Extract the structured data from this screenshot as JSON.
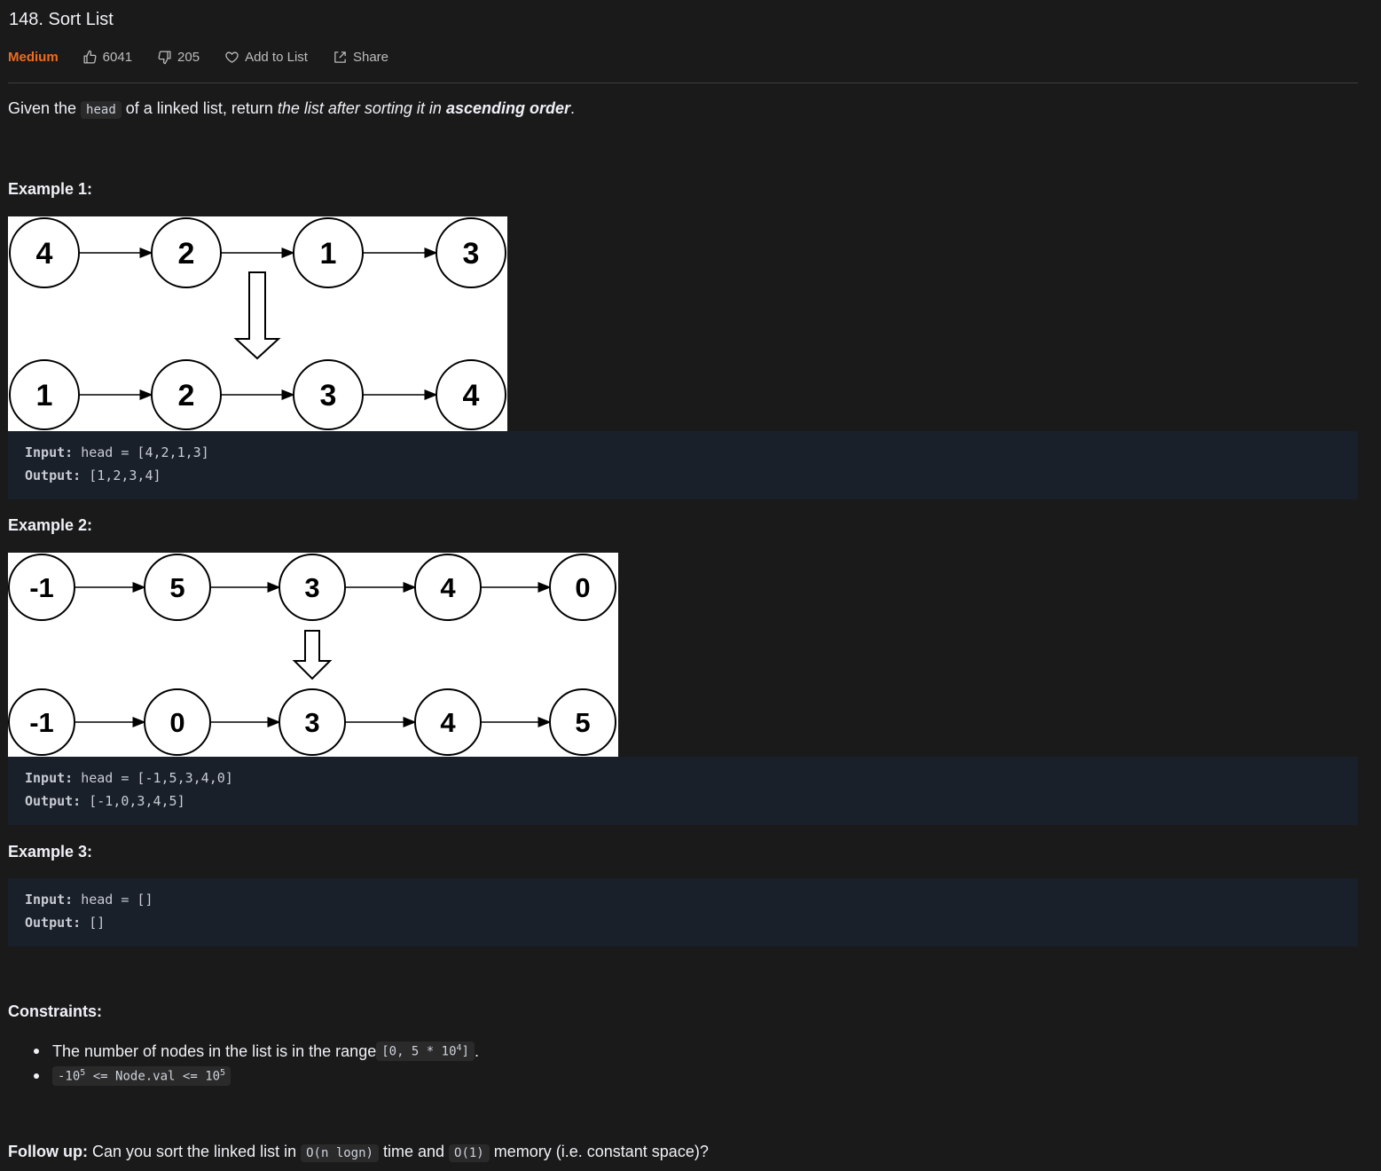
{
  "problem": {
    "title": "148. Sort List",
    "difficulty": "Medium",
    "likes": "6041",
    "dislikes": "205",
    "add_to_list": "Add to List",
    "share": "Share"
  },
  "description": {
    "prefix": "Given the ",
    "code": "head",
    "middle": " of a linked list, return ",
    "italic": "the list after sorting it in ",
    "bold_italic": "ascending order",
    "suffix": "."
  },
  "examples": [
    {
      "heading": "Example 1:",
      "diagram": {
        "before": [
          "4",
          "2",
          "1",
          "3"
        ],
        "after": [
          "1",
          "2",
          "3",
          "4"
        ]
      },
      "input_label": "Input:",
      "input_value": " head = [4,2,1,3]",
      "output_label": "Output:",
      "output_value": " [1,2,3,4]"
    },
    {
      "heading": "Example 2:",
      "diagram": {
        "before": [
          "-1",
          "5",
          "3",
          "4",
          "0"
        ],
        "after": [
          "-1",
          "0",
          "3",
          "4",
          "5"
        ]
      },
      "input_label": "Input:",
      "input_value": " head = [-1,5,3,4,0]",
      "output_label": "Output:",
      "output_value": " [-1,0,3,4,5]"
    },
    {
      "heading": "Example 3:",
      "input_label": "Input:",
      "input_value": " head = []",
      "output_label": "Output:",
      "output_value": " []"
    }
  ],
  "constraints": {
    "heading": "Constraints:",
    "items": [
      {
        "text": "The number of nodes in the list is in the range ",
        "code_pre": "[0, 5 * 10",
        "code_sup": "4",
        "code_post": "]",
        "suffix": "."
      },
      {
        "code_a": "-10",
        "sup_a": "5",
        "code_b": " <= Node.val <= 10",
        "sup_b": "5"
      }
    ]
  },
  "follow_up": {
    "label": "Follow up:",
    "text_a": " Can you sort the linked list in ",
    "code_a": "O(n logn)",
    "text_b": " time and ",
    "code_b": "O(1)",
    "text_c": " memory (i.e. constant space)?"
  },
  "colors": {
    "background": "#1a1a1a",
    "difficulty_medium": "#ef6c1d",
    "code_block": "#19202a"
  }
}
